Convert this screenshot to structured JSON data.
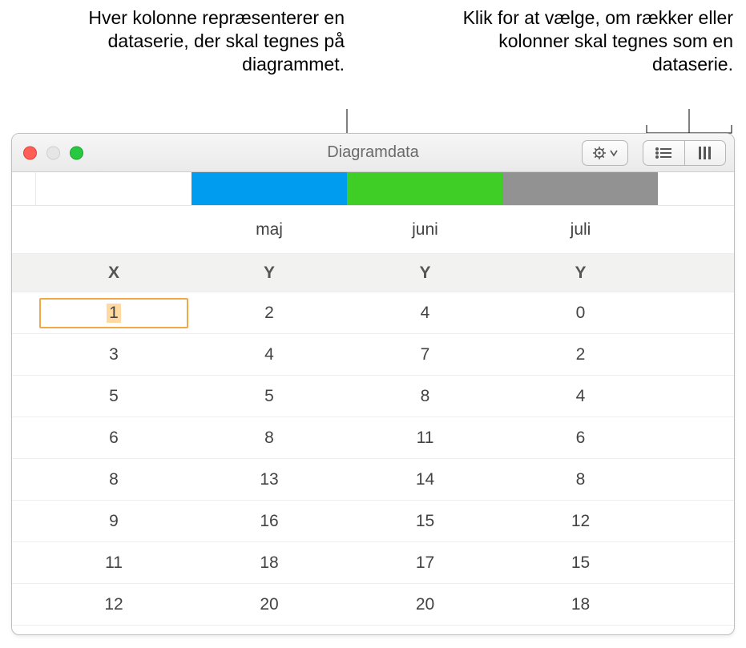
{
  "callouts": {
    "left": "Hver kolonne repræsenterer en dataserie, der skal tegnes på diagrammet.",
    "right": "Klik for at vælge, om rækker eller kolonner skal tegnes som en dataserie."
  },
  "window": {
    "title": "Diagramdata"
  },
  "toolbar": {
    "settings_icon": "gear-icon",
    "series_rows_icon": "rows-icon",
    "series_cols_icon": "cols-icon"
  },
  "columns": {
    "colors": [
      "",
      "#009cf0",
      "#3ece25",
      "#929292",
      ""
    ],
    "months": [
      "",
      "maj",
      "juni",
      "juli",
      ""
    ],
    "axis": [
      "X",
      "Y",
      "Y",
      "Y",
      ""
    ]
  },
  "rows": [
    {
      "x": "1",
      "y1": "2",
      "y2": "4",
      "y3": "0"
    },
    {
      "x": "3",
      "y1": "4",
      "y2": "7",
      "y3": "2"
    },
    {
      "x": "5",
      "y1": "5",
      "y2": "8",
      "y3": "4"
    },
    {
      "x": "6",
      "y1": "8",
      "y2": "11",
      "y3": "6"
    },
    {
      "x": "8",
      "y1": "13",
      "y2": "14",
      "y3": "8"
    },
    {
      "x": "9",
      "y1": "16",
      "y2": "15",
      "y3": "12"
    },
    {
      "x": "11",
      "y1": "18",
      "y2": "17",
      "y3": "15"
    },
    {
      "x": "12",
      "y1": "20",
      "y2": "20",
      "y3": "18"
    }
  ],
  "selected_cell": {
    "row": 0,
    "col": "x"
  },
  "chart_data": {
    "type": "table",
    "title": "Diagramdata",
    "series": [
      {
        "name": "maj",
        "color": "#009cf0",
        "x": [
          1,
          3,
          5,
          6,
          8,
          9,
          11,
          12
        ],
        "y": [
          2,
          4,
          5,
          8,
          13,
          16,
          18,
          20
        ]
      },
      {
        "name": "juni",
        "color": "#3ece25",
        "x": [
          1,
          3,
          5,
          6,
          8,
          9,
          11,
          12
        ],
        "y": [
          4,
          7,
          8,
          11,
          14,
          15,
          17,
          20
        ]
      },
      {
        "name": "juli",
        "color": "#929292",
        "x": [
          1,
          3,
          5,
          6,
          8,
          9,
          11,
          12
        ],
        "y": [
          0,
          2,
          4,
          6,
          8,
          12,
          15,
          18
        ]
      }
    ],
    "xlabel": "X",
    "ylabel": "Y"
  }
}
